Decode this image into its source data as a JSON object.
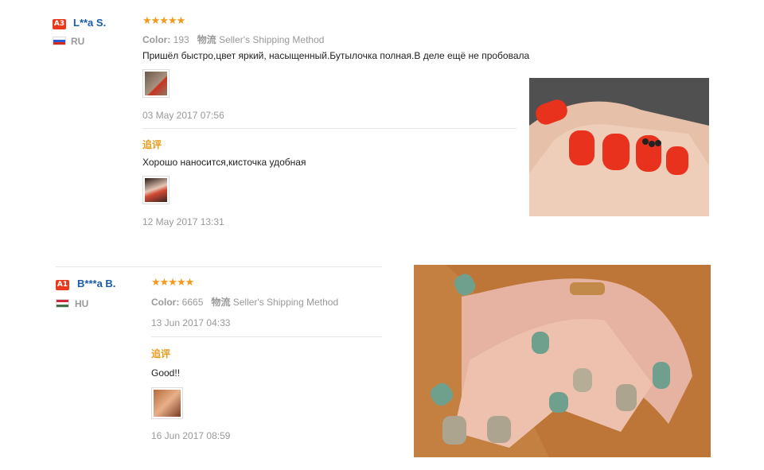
{
  "reviews": [
    {
      "level": "A3",
      "level_color": "#e8391c",
      "user": "L**a S.",
      "country": "RU",
      "stars": "★★★★★",
      "color_label": "Color:",
      "color_value": "193",
      "shipping_label": "物流",
      "shipping_value": "Seller's Shipping Method",
      "comment": "Пришёл быстро,цвет яркий, насыщенный.Бутылочка полная.В деле ещё не пробовала",
      "date": "03 May 2017 07:56",
      "followup_label": "追评",
      "followup_text": "Хорошо наносится,кисточка удобная",
      "followup_date": "12 May 2017 13:31"
    },
    {
      "level": "A1",
      "level_color": "#e8391c",
      "user": "B***a B.",
      "country": "HU",
      "stars": "★★★★★",
      "color_label": "Color:",
      "color_value": "6665",
      "shipping_label": "物流",
      "shipping_value": "Seller's Shipping Method",
      "date": "13 Jun 2017 04:33",
      "followup_label": "追评",
      "followup_text": "Good!!",
      "followup_date": "16 Jun 2017 08:59"
    }
  ]
}
